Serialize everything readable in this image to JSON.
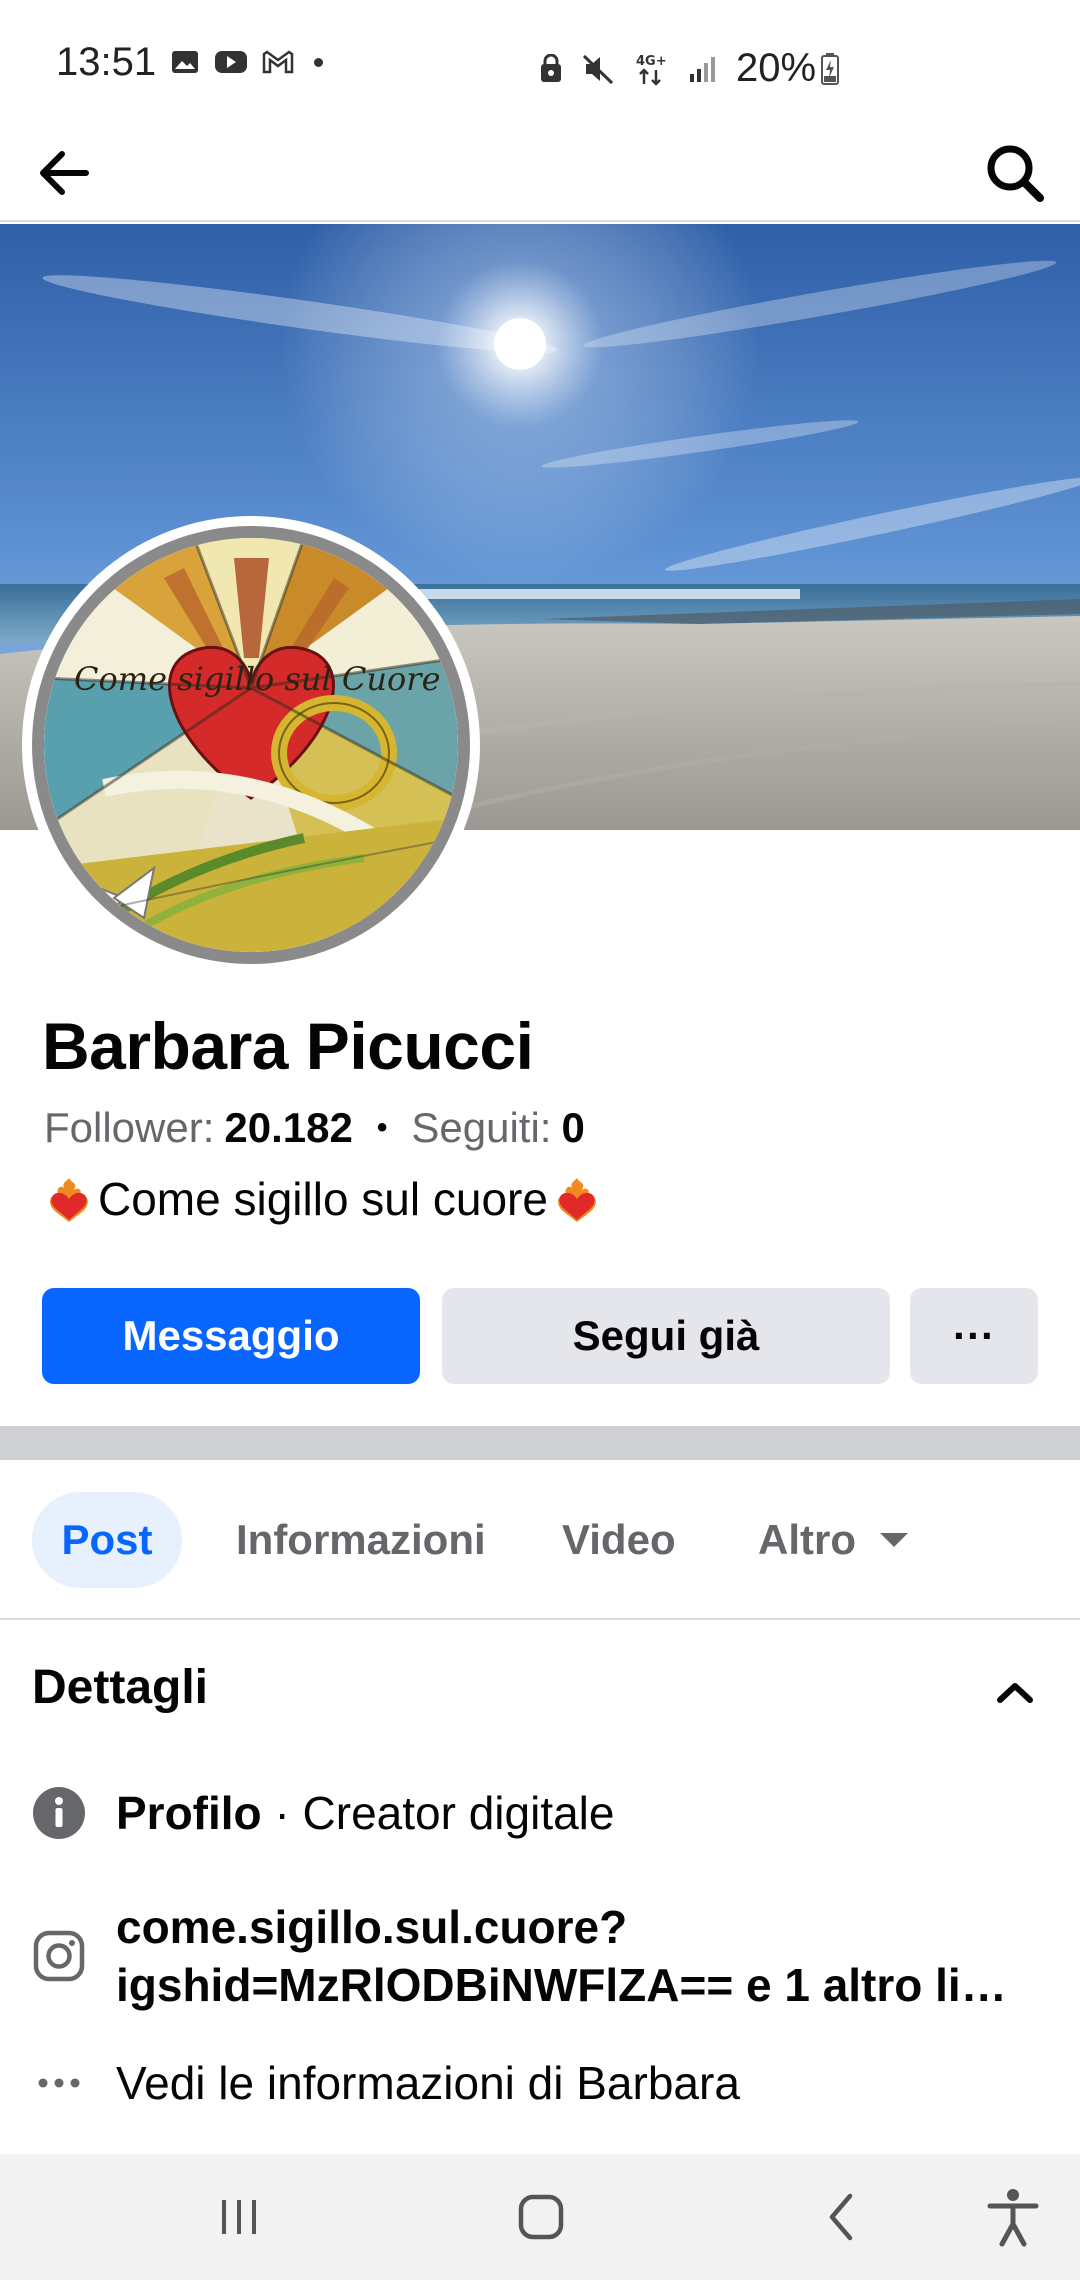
{
  "status_bar": {
    "time": "13:51",
    "battery": "20%",
    "left_icons": [
      "gallery-icon",
      "youtube-icon",
      "gmail-icon"
    ],
    "right_icons": [
      "lock-icon",
      "mute-icon",
      "4g-icon",
      "signal-icon",
      "battery-icon"
    ]
  },
  "profile": {
    "name": "Barbara Picucci",
    "followers_label": "Follower:",
    "followers_count": "20.182",
    "following_label": "Seguiti:",
    "following_count": "0",
    "bio": "Come sigillo sul cuore",
    "avatar_text": "Come sigillo sul Cuore"
  },
  "actions": {
    "message": "Messaggio",
    "follow": "Segui già",
    "more": "···"
  },
  "tabs": [
    {
      "label": "Post",
      "active": true
    },
    {
      "label": "Informazioni"
    },
    {
      "label": "Video"
    },
    {
      "label": "Altro"
    }
  ],
  "details": {
    "title": "Dettagli",
    "profile_label": "Profilo",
    "profile_role": " · Creator digitale",
    "instagram_line1": "come.sigillo.sul.cuore?",
    "instagram_line2": "igshid=MzRlODBiNWFlZA== e 1 altro li…",
    "see_more": "Vedi le informazioni di Barbara"
  },
  "colors": {
    "primary": "#0866ff",
    "secondary_button": "#e4e6eb",
    "tab_active_bg": "#e7f0fd"
  }
}
